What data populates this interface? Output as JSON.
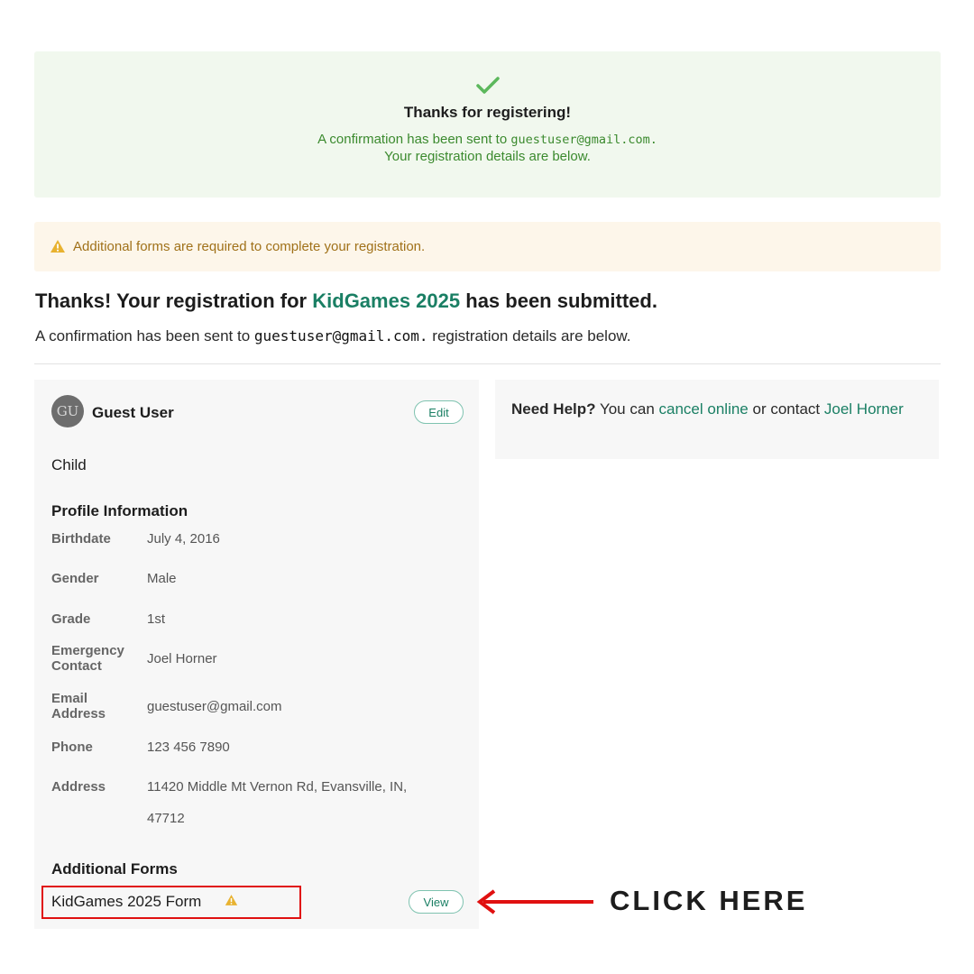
{
  "success_banner": {
    "title": "Thanks for registering!",
    "line1_prefix": "A confirmation has been sent to",
    "email": "guestuser@gmail.com.",
    "line2": "Your registration details are below."
  },
  "warning_banner": {
    "text": "Additional forms are required to complete your registration."
  },
  "headline": {
    "prefix": "Thanks! Your registration for",
    "event_name": "KidGames 2025",
    "suffix": "has been submitted."
  },
  "subline": {
    "prefix": "A confirmation has been sent to",
    "email": "guestuser@gmail.com.",
    "suffix": "registration details are below."
  },
  "profile": {
    "avatar_initials": "GU",
    "name": "Guest User",
    "edit_label": "Edit",
    "relationship": "Child",
    "section_title": "Profile Information",
    "fields": [
      {
        "label": "Birthdate",
        "value": "July 4, 2016"
      },
      {
        "label": "Gender",
        "value": "Male"
      },
      {
        "label": "Grade",
        "value": "1st"
      },
      {
        "label": "Emergency Contact",
        "value": "Joel Horner"
      },
      {
        "label": "Email Address",
        "value": "guestuser@gmail.com"
      },
      {
        "label": "Phone",
        "value": "123 456 7890"
      },
      {
        "label": "Address",
        "value": "11420 Middle Mt Vernon Rd, Evansville, IN, 47712"
      }
    ],
    "additional_forms_title": "Additional Forms",
    "forms": [
      {
        "name": "KidGames 2025 Form",
        "view_label": "View"
      }
    ]
  },
  "help": {
    "bold": "Need Help?",
    "text1": "You can",
    "link1": "cancel online",
    "text2": "or contact",
    "link2": "Joel Horner"
  },
  "annotation": {
    "label": "CLICK HERE"
  },
  "colors": {
    "accent": "#1a7f64",
    "success_bg": "#f1f8ee",
    "success_text": "#3b8a2e",
    "warning_bg": "#fdf6ea",
    "warning_text": "#a07119",
    "highlight": "#e01010"
  }
}
